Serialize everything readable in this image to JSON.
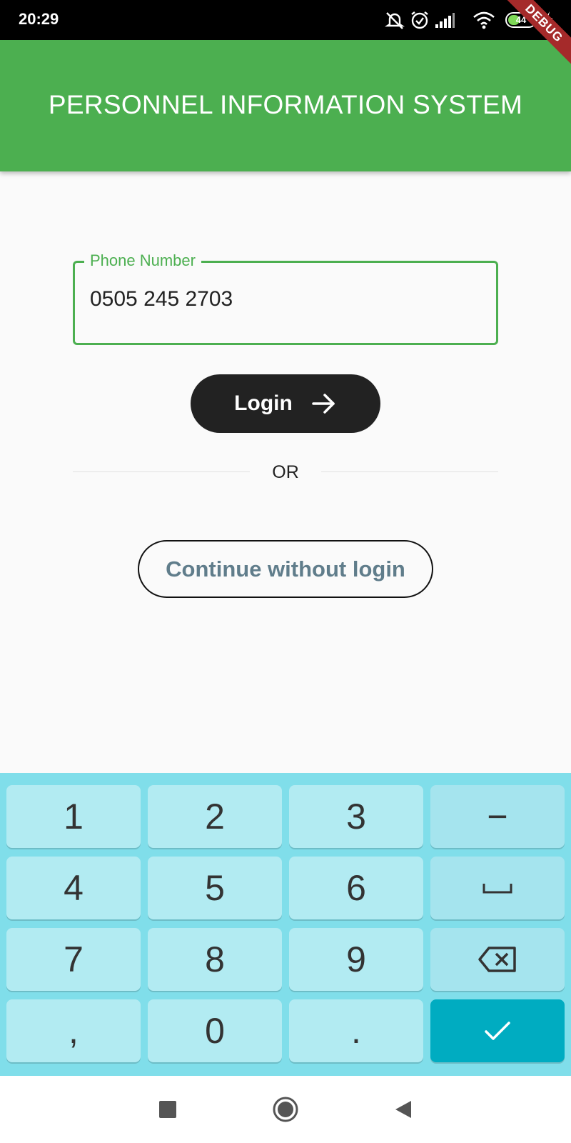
{
  "status_bar": {
    "time": "20:29",
    "battery_level": "44",
    "icons": [
      "bell-muted-icon",
      "alarm-icon",
      "signal-icon",
      "wifi-icon",
      "battery-icon",
      "charging-icon"
    ]
  },
  "debug_banner": "DEBUG",
  "app_bar": {
    "title": "PERSONNEL INFORMATION SYSTEM",
    "color": "#4caf50"
  },
  "form": {
    "phone_label": "Phone Number",
    "phone_value": "0505 245 2703",
    "login_label": "Login",
    "or_text": "OR",
    "continue_label": "Continue without login"
  },
  "keyboard": {
    "keys": [
      "1",
      "2",
      "3",
      "−",
      "4",
      "5",
      "6",
      "7",
      "8",
      "9",
      ",",
      "0",
      "."
    ],
    "function_keys": [
      "space-key-icon",
      "backspace-icon",
      "done-check-icon"
    ]
  },
  "nav_bar": {
    "icons": [
      "recents-square-icon",
      "home-circle-icon",
      "back-triangle-icon"
    ]
  },
  "colors": {
    "accent": "#4caf50",
    "keyboard_bg": "#80deea",
    "key_bg": "#b2ebf2",
    "done_key": "#00acc1"
  }
}
